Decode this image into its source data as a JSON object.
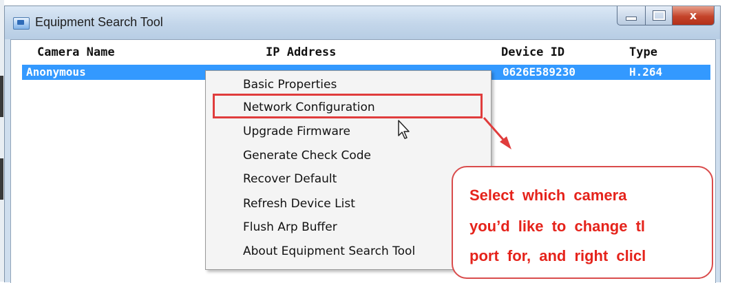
{
  "window": {
    "title": "Equipment Search Tool",
    "controls": {
      "minimize": "minimize",
      "maximize": "maximize",
      "close": "x"
    }
  },
  "columns": [
    "Camera Name",
    "IP Address",
    "Device ID",
    "Type"
  ],
  "rows": [
    {
      "camera_name": "Anonymous",
      "ip_address": "",
      "device_id": "0626E589230",
      "type": "H.264",
      "selected": true
    }
  ],
  "context_menu": {
    "items": [
      "Basic Properties",
      "Network Configuration",
      "Upgrade Firmware",
      "Generate Check Code",
      "Recover Default",
      "Refresh Device List",
      "Flush Arp Buffer",
      "About Equipment Search Tool"
    ],
    "highlighted_item": "Network Configuration"
  },
  "callout": {
    "lines": [
      "Select which camera",
      "you’d like to change tl",
      "port for, and right clicl"
    ]
  },
  "colors": {
    "selection": "#3399ff",
    "annotation_red": "#e5231b",
    "titlebar": "#c3d6ea",
    "close_button": "#c4442a"
  }
}
